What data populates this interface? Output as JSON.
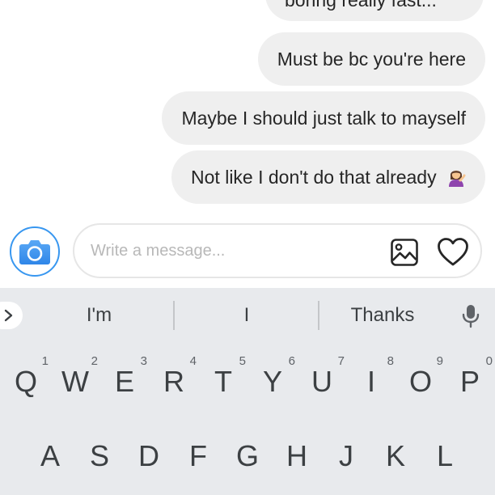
{
  "messages": [
    {
      "text": "boring really fast..."
    },
    {
      "text": "Must be bc you're here"
    },
    {
      "text": "Maybe I should just talk to mayself"
    },
    {
      "text": "Not like I don't do that already"
    }
  ],
  "emoji": {
    "name": "person-tipping-hand-emoji"
  },
  "composer": {
    "placeholder": "Write a message...",
    "camera_icon": "camera-icon",
    "gallery_icon": "gallery-icon",
    "heart_icon": "heart-icon",
    "accent_color": "#3897f0"
  },
  "keyboard": {
    "suggestions": [
      "I'm",
      "I",
      "Thanks"
    ],
    "expand_icon": "chevron-right-icon",
    "mic_icon": "mic-icon",
    "row1": [
      {
        "letter": "Q",
        "hint": "1"
      },
      {
        "letter": "W",
        "hint": "2"
      },
      {
        "letter": "E",
        "hint": "3"
      },
      {
        "letter": "R",
        "hint": "4"
      },
      {
        "letter": "T",
        "hint": "5"
      },
      {
        "letter": "Y",
        "hint": "6"
      },
      {
        "letter": "U",
        "hint": "7"
      },
      {
        "letter": "I",
        "hint": "8"
      },
      {
        "letter": "O",
        "hint": "9"
      },
      {
        "letter": "P",
        "hint": "0"
      }
    ],
    "row2": [
      "A",
      "S",
      "D",
      "F",
      "G",
      "H",
      "J",
      "K",
      "L"
    ]
  }
}
